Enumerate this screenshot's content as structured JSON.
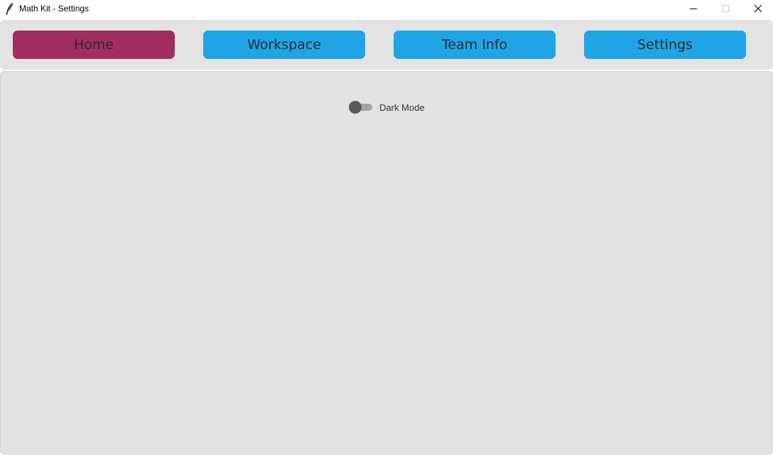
{
  "window": {
    "title": "Math Kit - Settings",
    "icon": "feather-icon"
  },
  "nav": {
    "items": [
      {
        "label": "Home",
        "active": true,
        "color": "#a12e5f"
      },
      {
        "label": "Workspace",
        "active": false,
        "color": "#1fa5e6"
      },
      {
        "label": "Team Info",
        "active": false,
        "color": "#1fa5e6"
      },
      {
        "label": "Settings",
        "active": false,
        "color": "#1fa5e6"
      }
    ]
  },
  "settings": {
    "dark_mode": {
      "label": "Dark Mode",
      "enabled": false
    }
  },
  "colors": {
    "accent_active": "#a12e5f",
    "accent_button": "#1fa5e6",
    "background": "#e2e2e2"
  }
}
